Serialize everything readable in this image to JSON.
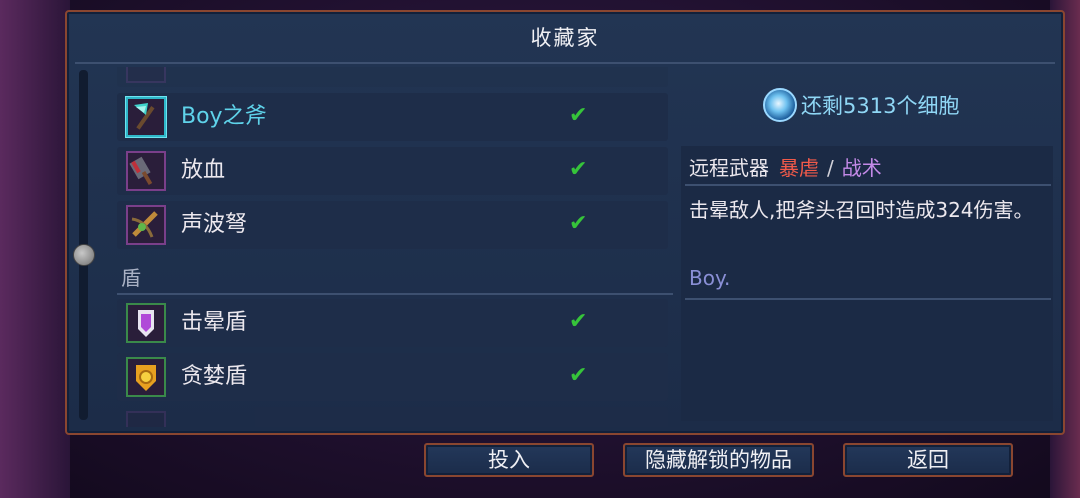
{
  "title": "收藏家",
  "colors": {
    "accent": "#5fd3ea",
    "brutality": "#f05a4a",
    "tactics": "#c48ae8",
    "check": "#36c43a",
    "frame": "#8a4630"
  },
  "list": {
    "rows": [
      {
        "label": "Boy之斧",
        "icon": "axe-icon",
        "selected": true,
        "check": "✔"
      },
      {
        "label": "放血",
        "icon": "cleaver-icon",
        "selected": false,
        "check": "✔"
      },
      {
        "label": "声波弩",
        "icon": "crossbow-icon",
        "selected": false,
        "check": "✔"
      }
    ],
    "category_shield": "盾",
    "shield_rows": [
      {
        "label": "击晕盾",
        "icon": "purple-shield-icon",
        "check": "✔"
      },
      {
        "label": "贪婪盾",
        "icon": "gold-shield-icon",
        "check": "✔"
      }
    ]
  },
  "detail": {
    "cells_text": "还剩5313个细胞",
    "type_base": "远程武器",
    "type_brutality": "暴虐",
    "type_slash": "/",
    "type_tactics": "战术",
    "description": "击晕敌人,把斧头召回时造成324伤害。",
    "flavor": "Boy."
  },
  "buttons": {
    "invest": "投入",
    "hide_unlocked": "隐藏解锁的物品",
    "back": "返回"
  }
}
